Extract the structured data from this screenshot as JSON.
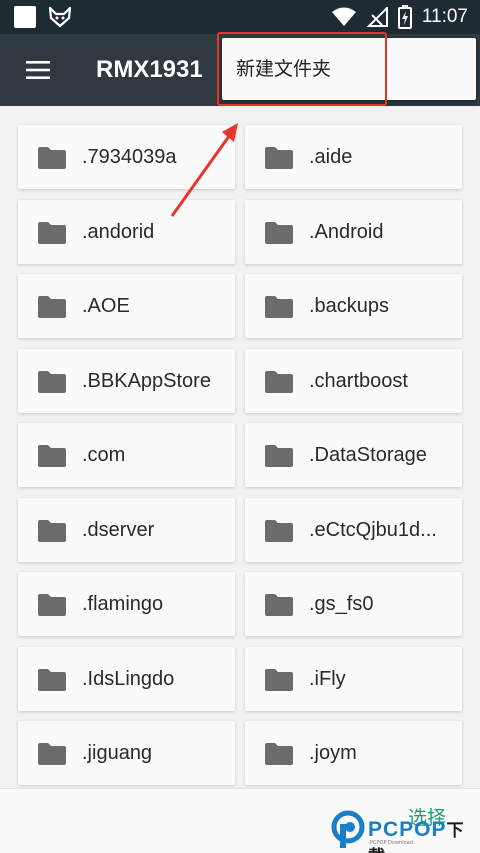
{
  "status_bar": {
    "time": "11:07"
  },
  "app_bar": {
    "title": "RMX1931"
  },
  "popup_menu": {
    "items": [
      {
        "label": "新建文件夹"
      }
    ]
  },
  "folders": [
    ".7934039a",
    ".aide",
    ".andorid",
    ".Android",
    ".AOE",
    ".backups",
    ".BBKAppStore",
    ".chartboost",
    ".com",
    ".DataStorage",
    ".dserver",
    ".eCtcQjbu1d...",
    ".flamingo",
    ".gs_fs0",
    ".IdsLingdo",
    ".iFly",
    ".jiguang",
    ".joym"
  ],
  "bottom_bar": {
    "select_label": "选择"
  },
  "watermark": {
    "brand": "PCPOP",
    "brand_cn": "下载",
    "sub": "PCPOP Download"
  },
  "colors": {
    "app_bar": "#2e3a40",
    "status_bar": "#1f2b33",
    "accent": "#1e9a7a",
    "annotation": "#e8342c",
    "folder_icon": "#6b6b6b"
  }
}
